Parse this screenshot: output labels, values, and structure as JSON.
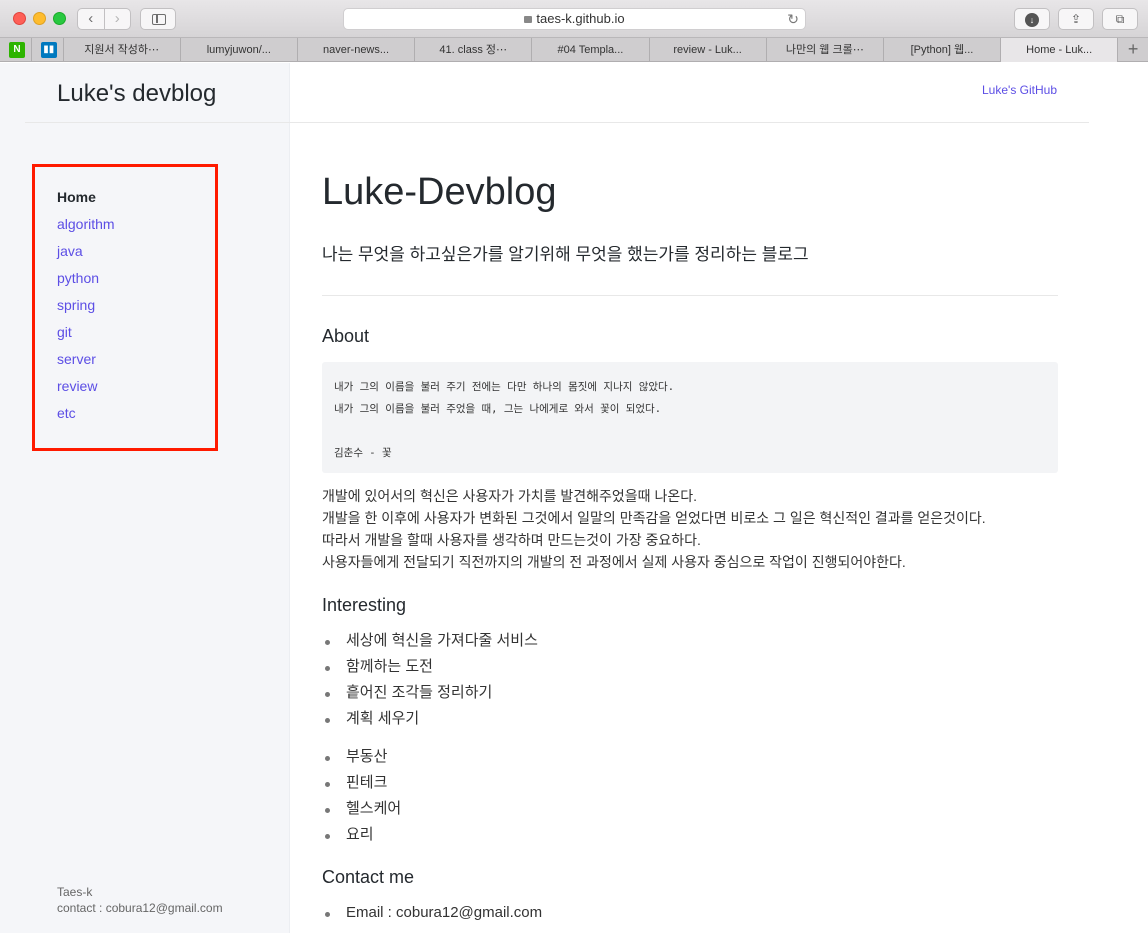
{
  "browser": {
    "url": "taes-k.github.io",
    "tabs": [
      "지원서 작성하⋯",
      "lumyjuwon/...",
      "naver-news...",
      "41. class 정⋯",
      "#04 Templa...",
      "review - Luk...",
      "나만의 웹 크롤⋯",
      "[Python] 웹...",
      "Home - Luk..."
    ],
    "active_tab": 8
  },
  "site": {
    "title": "Luke's devblog",
    "github_link": "Luke's GitHub"
  },
  "nav": {
    "items": [
      "Home",
      "algorithm",
      "java",
      "python",
      "spring",
      "git",
      "server",
      "review",
      "etc"
    ]
  },
  "footer": {
    "name": "Taes-k",
    "contact": "contact : cobura12@gmail.com"
  },
  "main": {
    "title": "Luke-Devblog",
    "subtitle": "나는 무엇을 하고싶은가를 알기위해 무엇을 했는가를 정리하는 블로그",
    "about_heading": "About",
    "quote_lines": [
      "내가 그의 이름을 불러 주기 전에는 다만 하나의 몸짓에 지나지 않았다.",
      "내가 그의 이름을 불러 주었을 때, 그는 나에게로 와서 꽃이 되었다."
    ],
    "quote_author": "김춘수 - 꽃",
    "paragraph_lines": [
      "개발에 있어서의 혁신은 사용자가 가치를 발견해주었을때 나온다.",
      "개발을 한 이후에 사용자가 변화된 그것에서 일말의 만족감을 얻었다면 비로소 그 일은 혁신적인 결과를 얻은것이다.",
      "따라서 개발을 할때 사용자를 생각하며 만드는것이 가장 중요하다.",
      "사용자들에게 전달되기 직전까지의 개발의 전 과정에서 실제 사용자 중심으로 작업이 진행되어야한다."
    ],
    "interesting_heading": "Interesting",
    "interesting_list_1": [
      "세상에 혁신을 가져다줄 서비스",
      "함께하는 도전",
      "흩어진 조각들 정리하기",
      "계획 세우기"
    ],
    "interesting_list_2": [
      "부동산",
      "핀테크",
      "헬스케어",
      "요리"
    ],
    "contact_heading": "Contact me",
    "contact_list": [
      "Email : cobura12@gmail.com"
    ]
  },
  "colors": {
    "link": "#5c4ee5",
    "highlight_box": "#ff1a00",
    "sidebar_bg": "#f5f6f9"
  }
}
